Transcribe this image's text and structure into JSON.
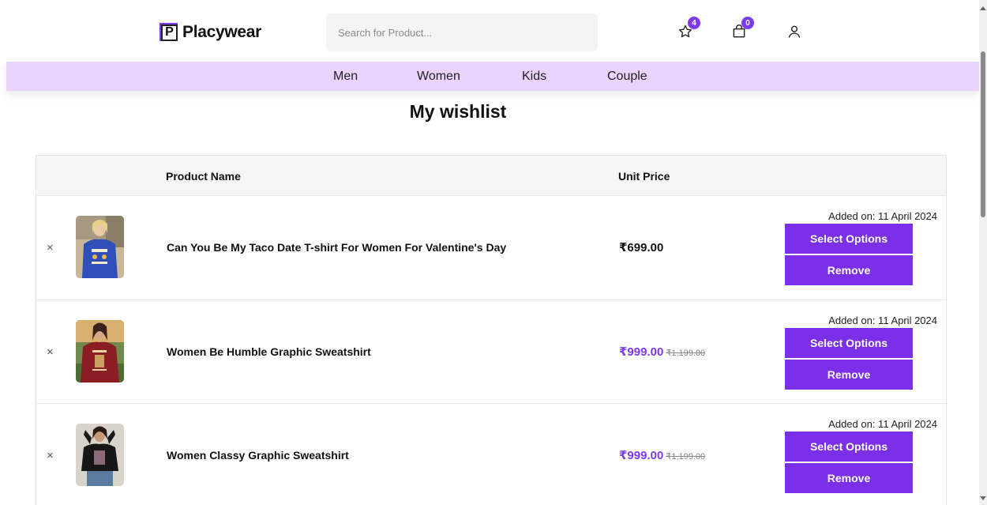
{
  "header": {
    "logo_text": "Placywear",
    "logo_letter": "P",
    "search_placeholder": "Search for Product...",
    "wishlist_count": "4",
    "cart_count": "0",
    "accent_color": "#7c3aed"
  },
  "nav": {
    "items": [
      "Men",
      "Women",
      "Kids",
      "Couple"
    ],
    "background": "#ebd3ff"
  },
  "page": {
    "title": "My wishlist"
  },
  "table": {
    "headers": {
      "product_name": "Product Name",
      "unit_price": "Unit Price"
    },
    "rows": [
      {
        "name": "Can You Be My Taco Date T-shirt For Women For Valentine's Day",
        "price": "₹699.00",
        "old_price": "",
        "added_on": "Added on: 11 April 2024",
        "select_label": "Select Options",
        "remove_label": "Remove",
        "remove_icon": "×",
        "image": "woman-blue-tshirt"
      },
      {
        "name": "Women Be Humble Graphic Sweatshirt",
        "price": "₹999.00",
        "old_price": "₹1,199.00",
        "added_on": "Added on: 11 April 2024",
        "select_label": "Select Options",
        "remove_label": "Remove",
        "remove_icon": "×",
        "image": "woman-maroon-sweatshirt"
      },
      {
        "name": "Women Classy Graphic Sweatshirt",
        "price": "₹999.00",
        "old_price": "₹1,199.00",
        "added_on": "Added on: 11 April 2024",
        "select_label": "Select Options",
        "remove_label": "Remove",
        "remove_icon": "×",
        "image": "woman-black-sweatshirt"
      }
    ]
  }
}
